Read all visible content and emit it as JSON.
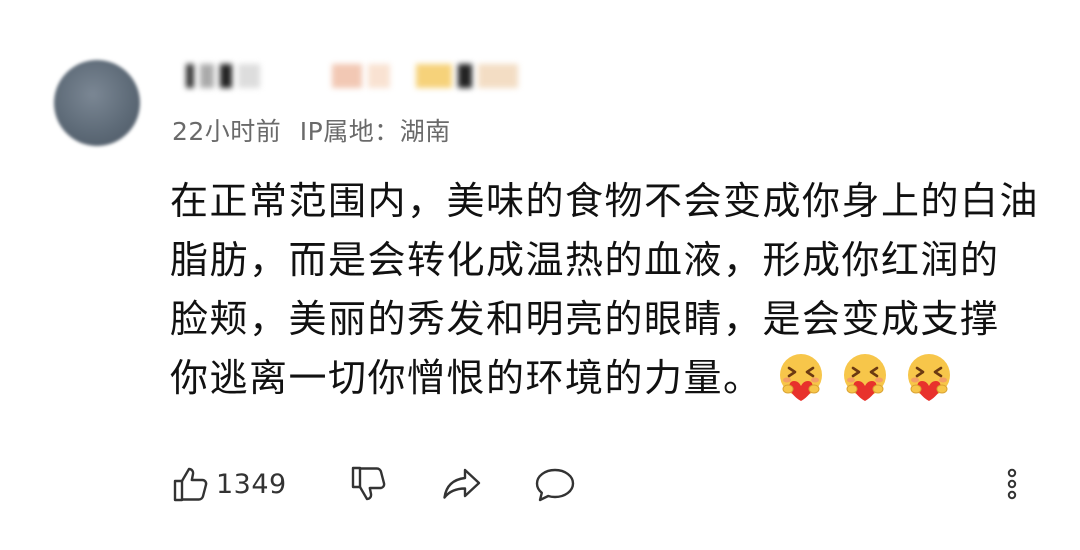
{
  "comment": {
    "username": "用户",
    "meta": {
      "time": "22小时前",
      "ip": "IP属地：湖南"
    },
    "lines": [
      "在正常范围内，美味的食物不会变成你身上的白油",
      "脂肪，而是会转化成温热的血液，形成你红润的",
      "脸颊，美丽的秀发和明亮的眼睛，是会变成支撑",
      "你逃离一切你憎恨的环境的力量。"
    ],
    "emojis": [
      "hug-heart-emoji",
      "hug-heart-emoji",
      "hug-heart-emoji"
    ],
    "actions": {
      "like_count": "1349",
      "icons": [
        "thumbs-up-icon",
        "thumbs-down-icon",
        "share-icon",
        "reply-icon",
        "more-icon"
      ]
    }
  },
  "colors": {
    "text": "#111111",
    "meta": "#6a6a6a",
    "icon": "#333333",
    "emoji_face": "#f7c64a",
    "emoji_heart": "#e8322c"
  }
}
